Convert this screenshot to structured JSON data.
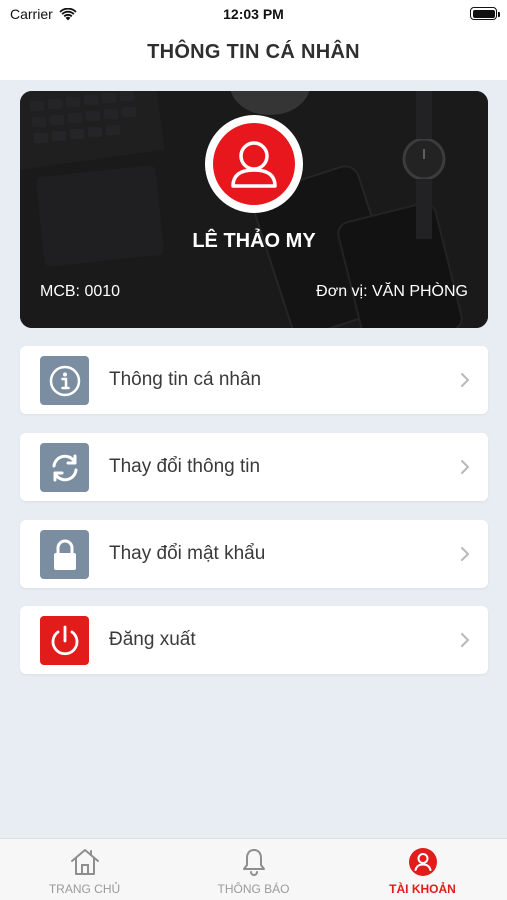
{
  "status_bar": {
    "carrier": "Carrier",
    "time": "12:03 PM"
  },
  "header": {
    "title": "THÔNG TIN CÁ NHÂN"
  },
  "profile": {
    "name": "LÊ THẢO MY",
    "code": "MCB: 0010",
    "unit": "Đơn vị: VĂN PHÒNG",
    "avatar_color": "#e8171d"
  },
  "menu": {
    "items": [
      {
        "label": "Thông tin cá nhân",
        "icon": "info-icon"
      },
      {
        "label": "Thay đổi thông tin",
        "icon": "sync-icon"
      },
      {
        "label": "Thay đổi mật khẩu",
        "icon": "lock-icon"
      },
      {
        "label": "Đăng xuất",
        "icon": "power-icon"
      }
    ]
  },
  "tab_bar": {
    "tabs": [
      {
        "label": "TRANG CHỦ",
        "icon": "home-icon",
        "active": false
      },
      {
        "label": "THÔNG BÁO",
        "icon": "bell-icon",
        "active": false
      },
      {
        "label": "TÀI KHOẢN",
        "icon": "user-icon",
        "active": true
      }
    ],
    "active_color": "#e21b1b"
  }
}
